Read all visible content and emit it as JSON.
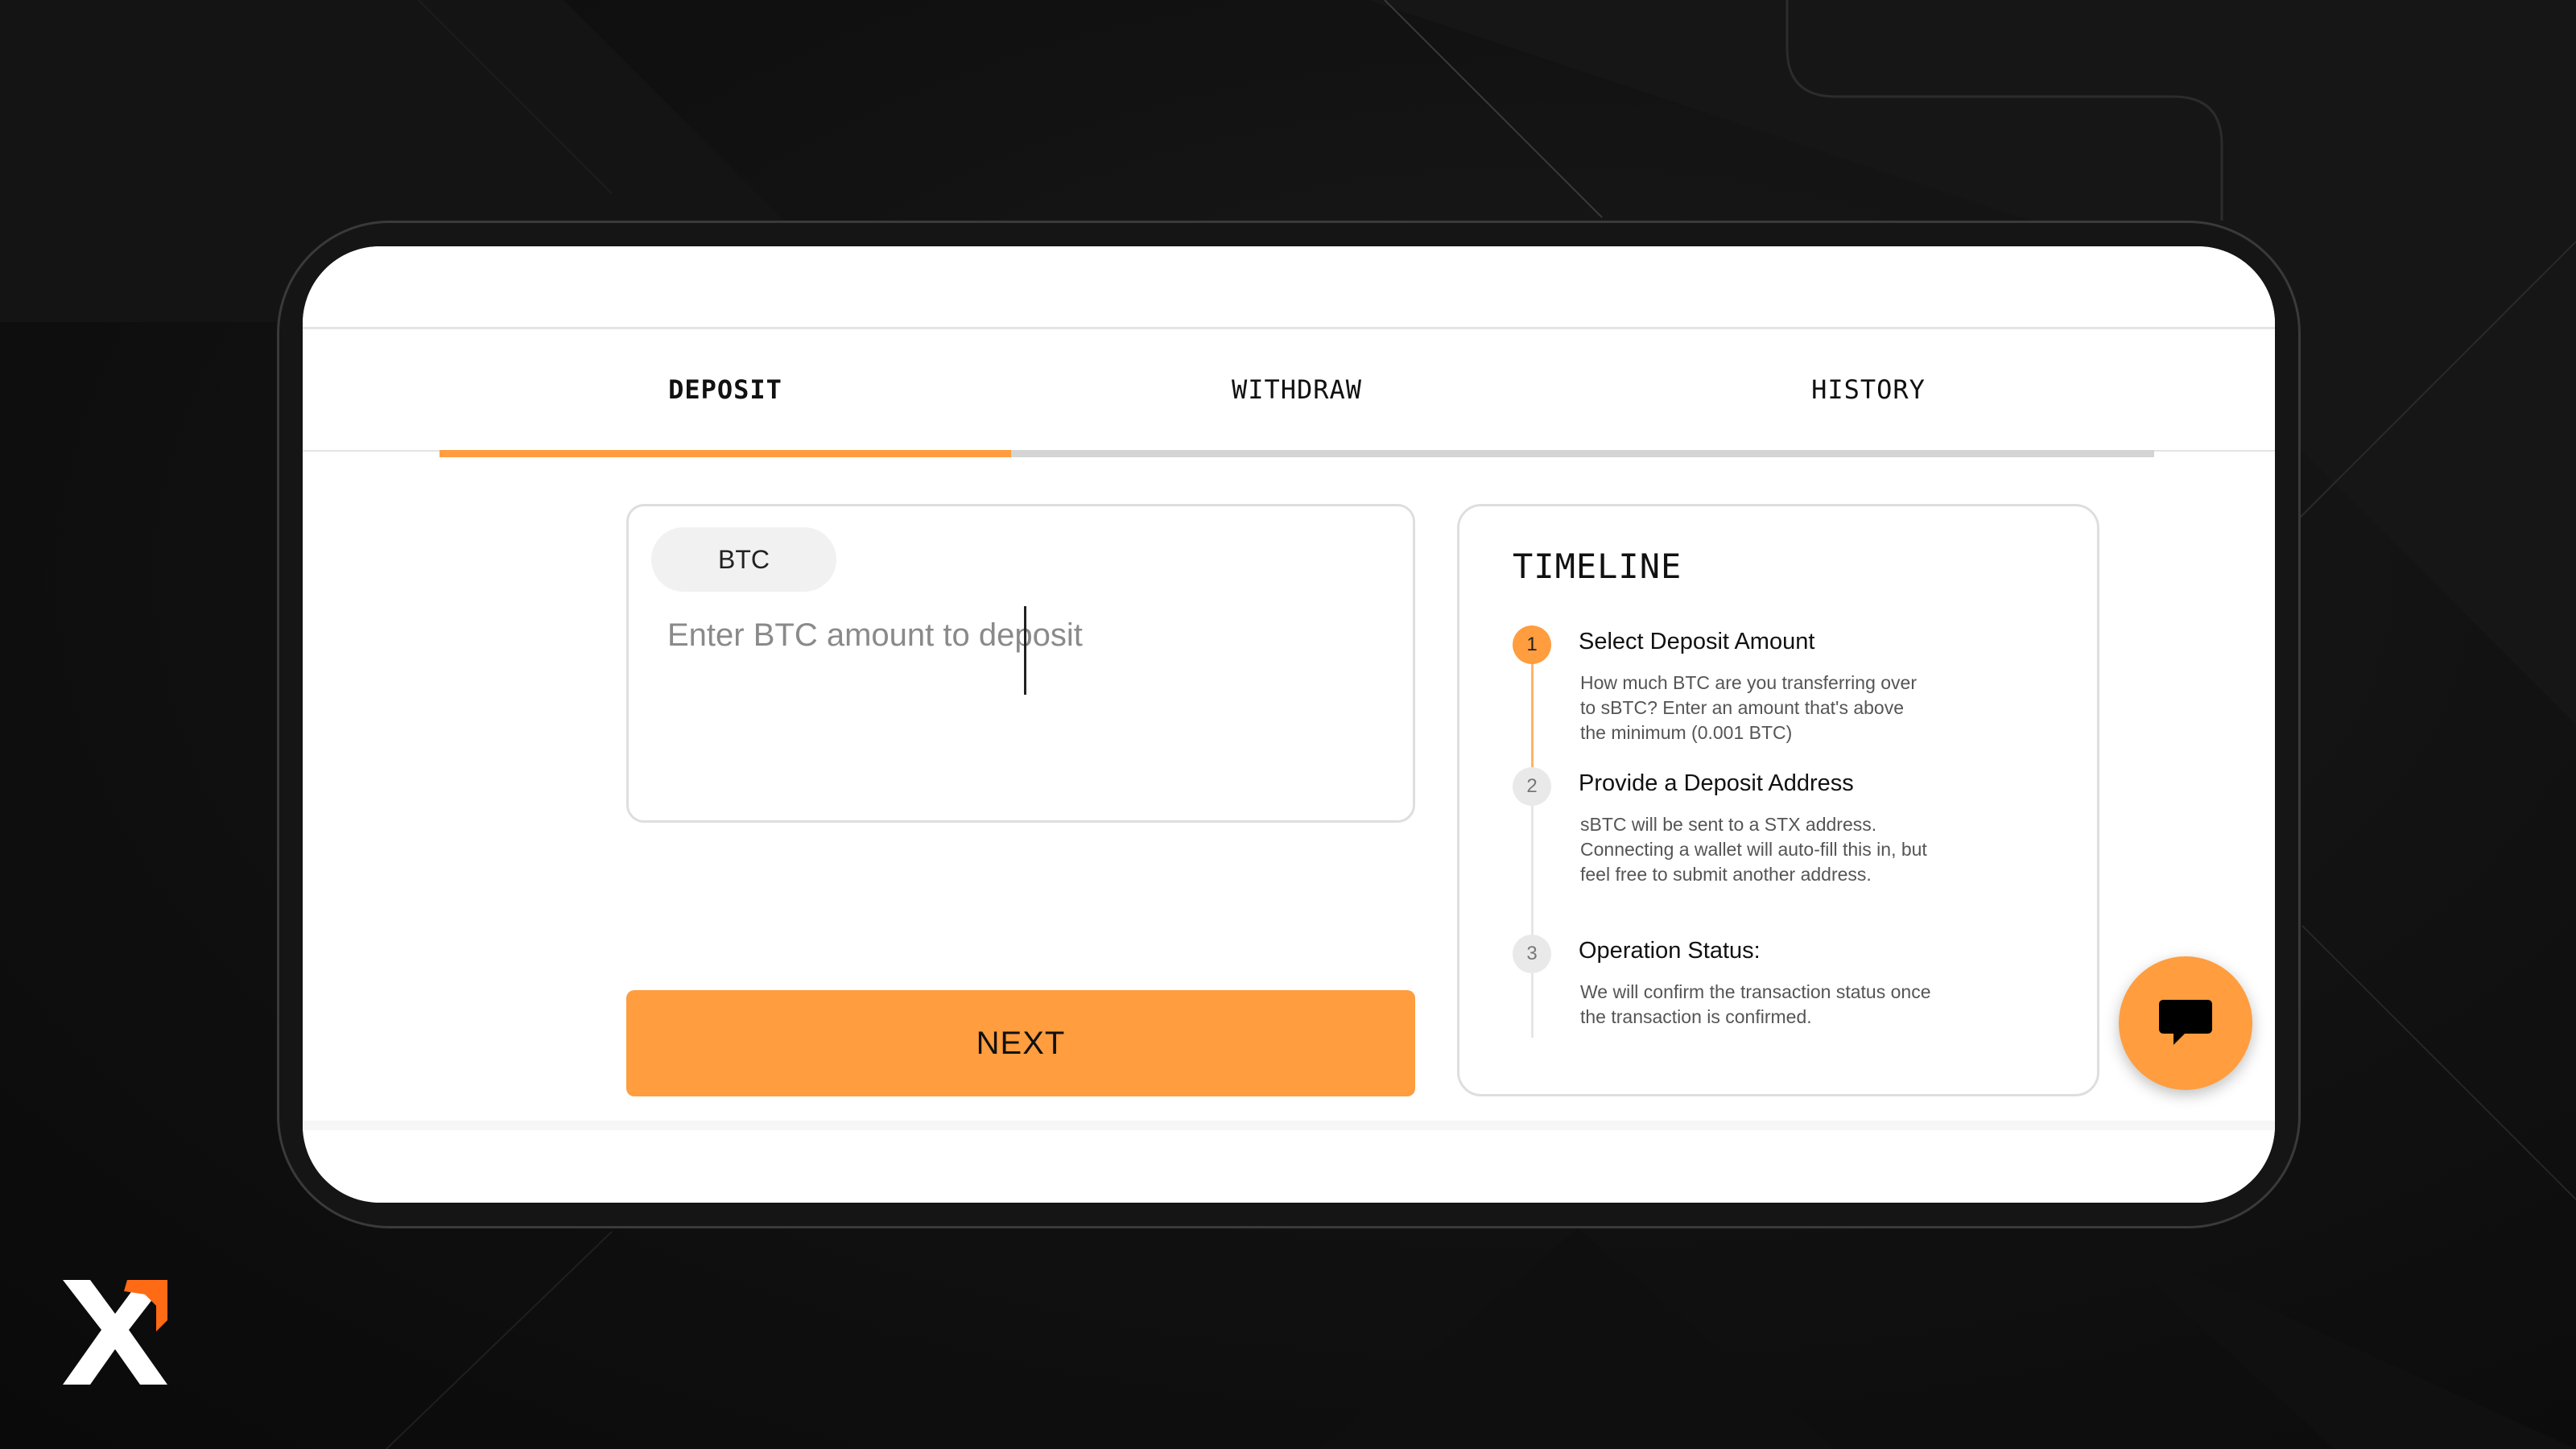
{
  "tabs": [
    {
      "label": "DEPOSIT",
      "active": true
    },
    {
      "label": "WITHDRAW",
      "active": false
    },
    {
      "label": "HISTORY",
      "active": false
    }
  ],
  "deposit": {
    "currency": "BTC",
    "amount_value": "",
    "amount_placeholder": "Enter BTC amount to deposit",
    "next_label": "NEXT"
  },
  "timeline": {
    "title": "TIMELINE",
    "steps": [
      {
        "number": "1",
        "title": "Select Deposit Amount",
        "description": "How much BTC are you transferring over to sBTC? Enter an amount that's above the minimum (0.001 BTC)",
        "active": true
      },
      {
        "number": "2",
        "title": "Provide a Deposit Address",
        "description": "sBTC will be sent to a STX address. Connecting a wallet will auto-fill this in, but feel free to submit another address.",
        "active": false
      },
      {
        "number": "3",
        "title": "Operation Status:",
        "description": "We will confirm the transaction status once the transaction is confirmed.",
        "active": false
      }
    ]
  },
  "icons": {
    "chat": "chat-bubble-icon",
    "logo": "brand-logo"
  },
  "colors": {
    "accent": "#ff9d3f",
    "background": "#0b0b0b",
    "card_border": "#dedede"
  }
}
